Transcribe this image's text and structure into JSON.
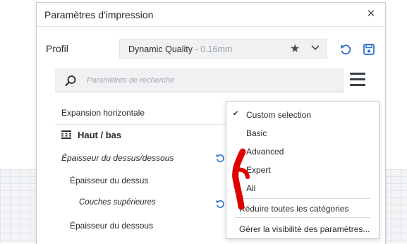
{
  "dialog": {
    "title": "Paramètres d'impression",
    "close_icon": "close-icon"
  },
  "profile": {
    "label": "Profil",
    "name": "Dynamic Quality",
    "separator": " - ",
    "layer_height": "0.16mm",
    "star_icon": "star-icon",
    "chevron_icon": "chevron-down-icon",
    "reset_icon": "reset-icon",
    "save_icon": "save-icon"
  },
  "search": {
    "placeholder": "Paramètres de recherche",
    "value": "",
    "icon": "search-icon",
    "menu_icon": "menu-icon"
  },
  "settings": {
    "rows": [
      {
        "label": "Expansion horizontale",
        "italic": false,
        "indent": 0
      },
      {
        "label": "Épaisseur du dessus/dessous",
        "italic": true,
        "indent": 0
      },
      {
        "label": "Épaisseur du dessus",
        "italic": false,
        "indent": 1
      },
      {
        "label": "Couches supérieures",
        "italic": true,
        "indent": 2
      },
      {
        "label": "Épaisseur du dessous",
        "italic": false,
        "indent": 1
      }
    ],
    "category": {
      "label": "Haut / bas",
      "icon": "top-bottom-icon"
    }
  },
  "visibility_menu": {
    "items": [
      "Custom selection",
      "Basic",
      "Advanced",
      "Expert",
      "All"
    ],
    "checked_item": "Custom selection",
    "collapse_all": "Réduire toutes les catégories",
    "manage_visibility": "Gérer la visibilité des paramètres..."
  },
  "colors": {
    "accent": "#2b6fd1",
    "annotation": "#e00000"
  }
}
